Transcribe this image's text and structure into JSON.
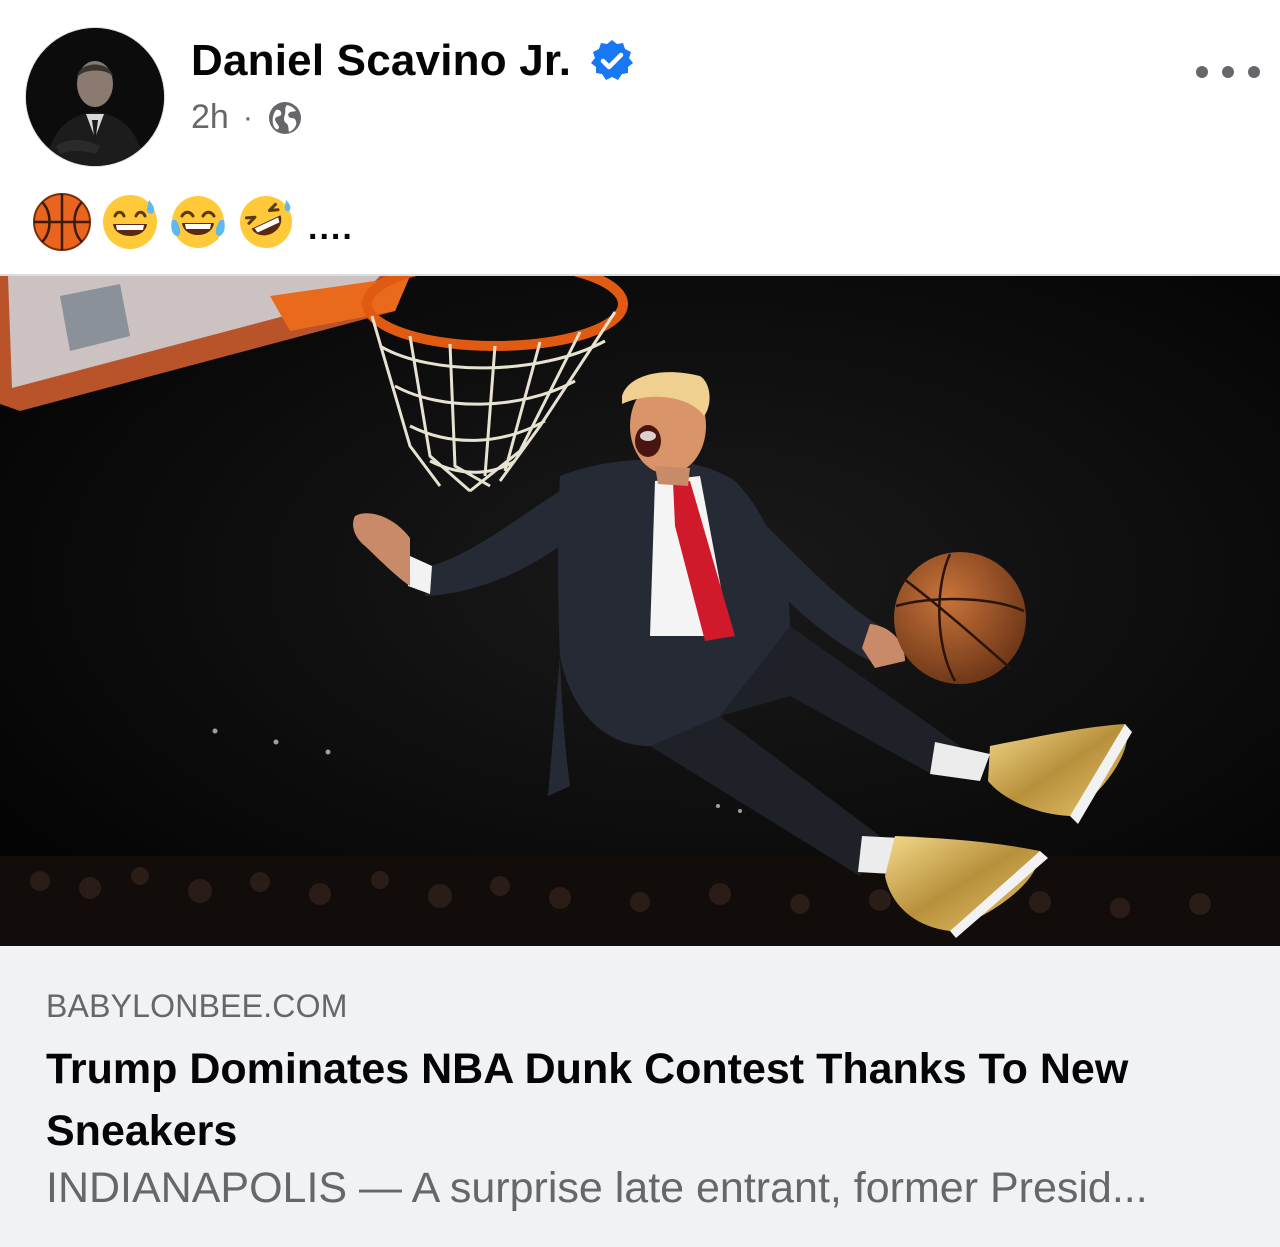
{
  "post": {
    "author_name": "Daniel Scavino Jr.",
    "timestamp": "2h",
    "separator": "·",
    "privacy_icon": "globe-icon",
    "verified_icon": "verified-badge-icon",
    "more_icon": "more-options-icon",
    "caption": {
      "emojis": [
        "basketball-emoji",
        "grinning-sweat-emoji",
        "tears-of-joy-emoji",
        "rolling-on-floor-laughing-emoji"
      ],
      "trailing_text": "...."
    }
  },
  "link_preview": {
    "domain": "BABYLONBEE.COM",
    "title": "Trump Dominates NBA Dunk Contest Thanks To New Sneakers",
    "description": "INDIANAPOLIS — A surprise late entrant, former Presid..."
  },
  "colors": {
    "verified_blue": "#1877f2",
    "secondary_text": "#65676b",
    "preview_background": "#f0f2f5"
  }
}
